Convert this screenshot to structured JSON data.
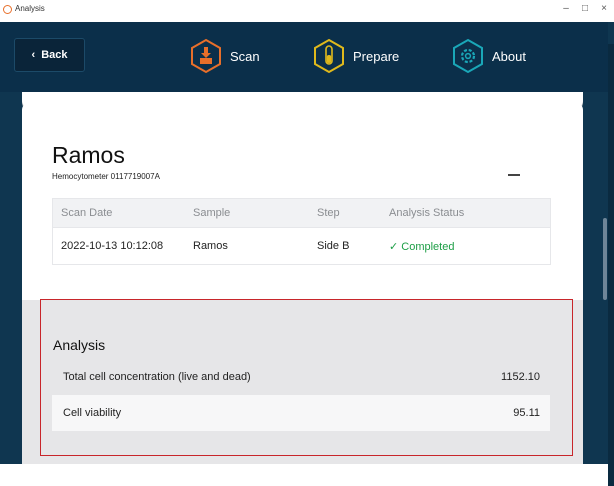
{
  "window": {
    "title": "Analysis",
    "controls": [
      "–",
      "□",
      "×"
    ]
  },
  "nav": {
    "back_label": "Back",
    "back_chevron": "‹",
    "items": [
      {
        "label": "Scan",
        "icon": "scan-icon",
        "color": "#e86f2a"
      },
      {
        "label": "Prepare",
        "icon": "prepare-icon",
        "color": "#e0b91c"
      },
      {
        "label": "About",
        "icon": "about-gear-icon",
        "color": "#1aa7b8"
      }
    ]
  },
  "sample": {
    "name": "Ramos",
    "subtitle": "Hemocytometer 0117719007A",
    "collapse_symbol": "–"
  },
  "scan_table": {
    "headers": [
      "Scan Date",
      "Sample",
      "Step",
      "Analysis Status"
    ],
    "rows": [
      {
        "scan_date": "2022-10-13 10:12:08",
        "sample": "Ramos",
        "step": "Side B",
        "status": "✓ Completed"
      }
    ]
  },
  "analysis": {
    "title": "Analysis",
    "rows": [
      {
        "label": "Total cell concentration (live and dead)",
        "value": "1152.10"
      },
      {
        "label": "Cell viability",
        "value": "95.11"
      }
    ]
  },
  "colors": {
    "navbar": "#0b2f4a",
    "app_background": "#0f3650",
    "completed": "#1d9e46",
    "highlight": "#c8262b"
  }
}
